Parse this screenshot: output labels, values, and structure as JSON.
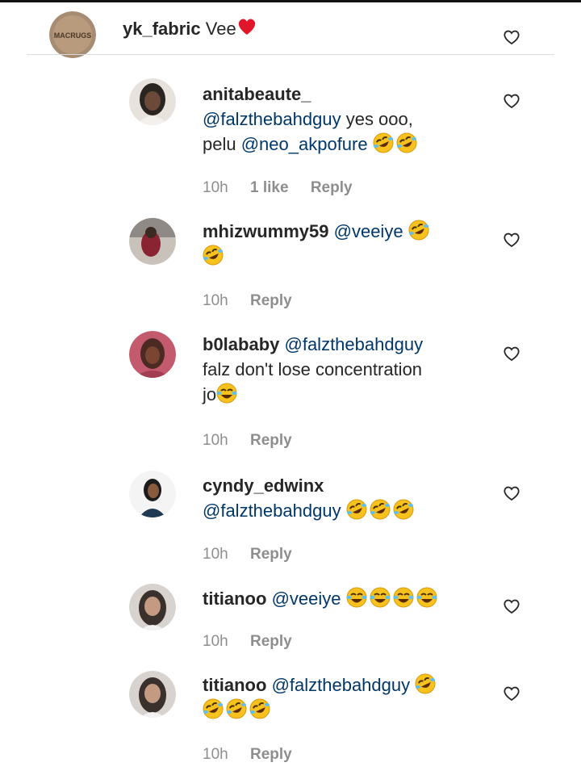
{
  "comments": [
    {
      "username": "yk_fabric",
      "text": "Vee",
      "emoji": [
        "heart"
      ],
      "avatar_label": "MACRUGS",
      "avatar_color": "#a58c72"
    },
    {
      "username": "anitabeaute_",
      "mention": "@falzthebahdguy",
      "text": "yes ooo,",
      "line2_text": "pelu",
      "line2_mention": "@neo_akpofure",
      "emoji": [
        "rofl",
        "rofl"
      ],
      "time": "10h",
      "likes": "1 like",
      "reply": "Reply",
      "avatar_color": "#2b2522"
    },
    {
      "username": "mhizwummy59",
      "mention": "@veeiye",
      "emoji": [
        "rofl",
        "rofl"
      ],
      "time": "10h",
      "reply": "Reply",
      "avatar_color": "#8a2433"
    },
    {
      "username": "b0lababy",
      "mention": "@falzthebahdguy",
      "line2_text": "falz don't lose concentration",
      "line3_text": "jo",
      "emoji": [
        "joy"
      ],
      "time": "10h",
      "reply": "Reply",
      "avatar_color": "#a23d52"
    },
    {
      "username": "cyndy_edwinx",
      "mention": "@falzthebahdguy",
      "emoji": [
        "rofl",
        "rofl",
        "rofl"
      ],
      "time": "10h",
      "reply": "Reply",
      "avatar_color": "#1f3a52"
    },
    {
      "username": "titianoo",
      "mention": "@veeiye",
      "emoji": [
        "joy",
        "joy",
        "joy",
        "joy"
      ],
      "time": "10h",
      "reply": "Reply",
      "avatar_color": "#3a302c"
    },
    {
      "username": "titianoo",
      "mention": "@falzthebahdguy",
      "emoji": [
        "rofl",
        "rofl",
        "rofl",
        "rofl"
      ],
      "time": "10h",
      "reply": "Reply",
      "avatar_color": "#3a302c"
    }
  ]
}
